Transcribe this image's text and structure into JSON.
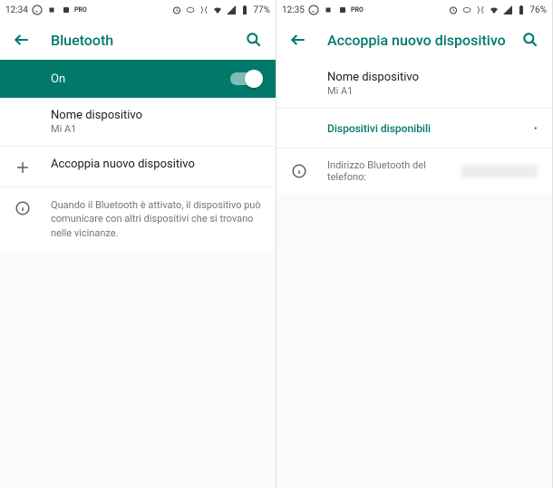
{
  "left": {
    "status": {
      "time": "12:34",
      "battery": "77%"
    },
    "title": "Bluetooth",
    "toggle_label": "On",
    "device_name_label": "Nome dispositivo",
    "device_name": "Mi A1",
    "pair_label": "Accoppia nuovo dispositivo",
    "info_text": "Quando il Bluetooth è attivato, il dispositivo può comunicare con altri dispositivi che si trovano nelle vicinanze."
  },
  "right": {
    "status": {
      "time": "12:35",
      "battery": "76%"
    },
    "title": "Accoppia nuovo dispositivo",
    "device_name_label": "Nome dispositivo",
    "device_name": "Mi A1",
    "section_header": "Dispositivi disponibili",
    "address_label": "Indirizzo Bluetooth del telefono:"
  }
}
